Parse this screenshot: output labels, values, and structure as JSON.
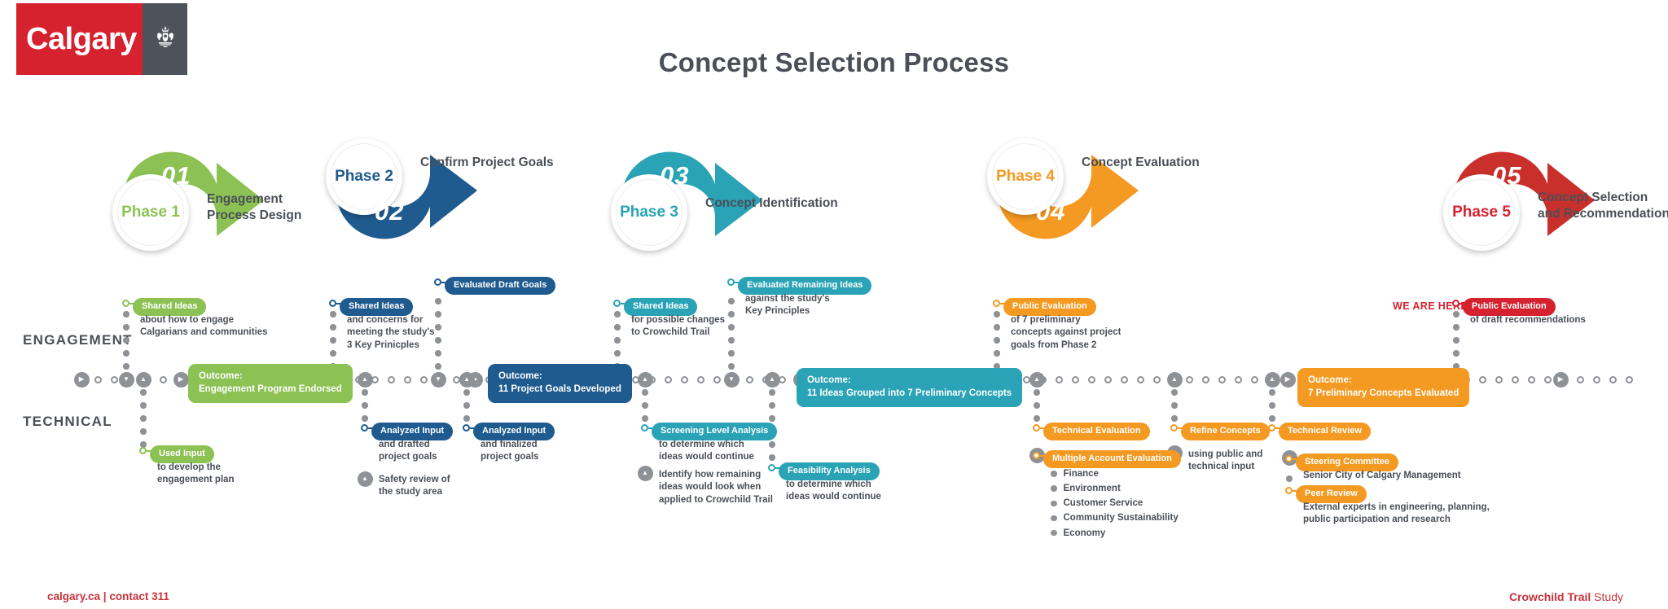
{
  "brand": {
    "logo_text": "Calgary",
    "logo_crest": "crest-icon"
  },
  "header": {
    "title": "Concept Selection Process"
  },
  "rows": {
    "engagement": "ENGAGEMENT",
    "technical": "TECHNICAL"
  },
  "colors": {
    "phase1": "#8CC153",
    "phase2": "#1F5B8F",
    "phase3": "#29A3B5",
    "phase4": "#F49A22",
    "phase5": "#D6212F",
    "grey": "#8E9196",
    "text": "#4A4F57",
    "calgary_red": "#D6212F"
  },
  "phases": [
    {
      "num": "01",
      "badge": "Phase 1",
      "caption": "Engagement\nProcess Design",
      "color": "#8CC153",
      "arrow": "up"
    },
    {
      "num": "02",
      "badge": "Phase 2",
      "caption": "Confirm Project Goals",
      "color": "#1F5B8F",
      "arrow": "down"
    },
    {
      "num": "03",
      "badge": "Phase 3",
      "caption": "Concept Identification",
      "color": "#29A3B5",
      "arrow": "up"
    },
    {
      "num": "04",
      "badge": "Phase 4",
      "caption": "Concept Evaluation",
      "color": "#F49A22",
      "arrow": "down"
    },
    {
      "num": "05",
      "badge": "Phase 5",
      "caption": "Concept Selection\nand Recommendation",
      "color": "#D6212F",
      "arrow": "up"
    }
  ],
  "markers": {
    "we_are_here": "WE ARE HERE"
  },
  "items": {
    "p1_shared": {
      "label": "Shared Ideas",
      "desc": "about how to engage\nCalgarians and communities"
    },
    "p1_outcome": {
      "title": "Outcome:",
      "sub": "Engagement Program Endorsed"
    },
    "p1_used": {
      "label": "Used Input",
      "desc": "to develop the\nengagement plan"
    },
    "p2_shared": {
      "label": "Shared Ideas",
      "desc": "and concerns for\nmeeting the study's\n3 Key Prinicples"
    },
    "p2_eval": {
      "label": "Evaluated Draft Goals",
      "desc": ""
    },
    "p2_outcome": {
      "title": "Outcome:",
      "sub": "11 Project Goals Developed"
    },
    "p2_an1": {
      "label": "Analyzed Input",
      "desc": "and drafted\nproject goals"
    },
    "p2_safety": {
      "desc": "Safety review of\nthe study area"
    },
    "p2_an2": {
      "label": "Analyzed Input",
      "desc": "and finalized\nproject goals"
    },
    "p3_shared": {
      "label": "Shared Ideas",
      "desc": "for possible changes\nto Crowchild Trail"
    },
    "p3_eval": {
      "label": "Evaluated Remaining Ideas",
      "desc": "against the study's\nKey Principles"
    },
    "p3_outcome": {
      "title": "Outcome:",
      "sub": "11 Ideas Grouped into 7 Preliminary Concepts"
    },
    "p3_screen": {
      "label": "Screening Level Analysis",
      "desc": "to determine which\nideas would continue"
    },
    "p3_identify": {
      "desc": "Identify how remaining\nideas would look when\napplied to Crowchild Trail"
    },
    "p3_feas": {
      "label": "Feasibility Analysis",
      "desc": "to determine which\nideas would continue"
    },
    "p4_public": {
      "label": "Public Evaluation",
      "desc": "of 7 preliminary\nconcepts against project\ngoals from Phase 2"
    },
    "p4_tech": {
      "label": "Technical Evaluation"
    },
    "p4_mae": {
      "label": "Multiple Account Evaluation",
      "bullets": [
        "Finance",
        "Environment",
        "Customer Service",
        "Community Sustainability",
        "Economy"
      ]
    },
    "p4_refine": {
      "label": "Refine Concepts",
      "desc": "using public and\ntechnical input"
    },
    "p4_outcome": {
      "title": "Outcome:",
      "sub": "7 Preliminary Concepts Evaluated"
    },
    "p5_techrev": {
      "label": "Technical Review"
    },
    "p5_steering": {
      "label": "Steering Committee",
      "desc": "Senior City of Calgary Management"
    },
    "p5_peer": {
      "label": "Peer Review",
      "desc": "External experts in engineering, planning,\npublic participation and research"
    },
    "p5_public": {
      "label": "Public Evaluation",
      "desc": "of draft recommendations"
    }
  },
  "footer": {
    "left": "calgary.ca | contact 311",
    "right_bold": "Crowchild Trail",
    "right_light": " Study"
  }
}
